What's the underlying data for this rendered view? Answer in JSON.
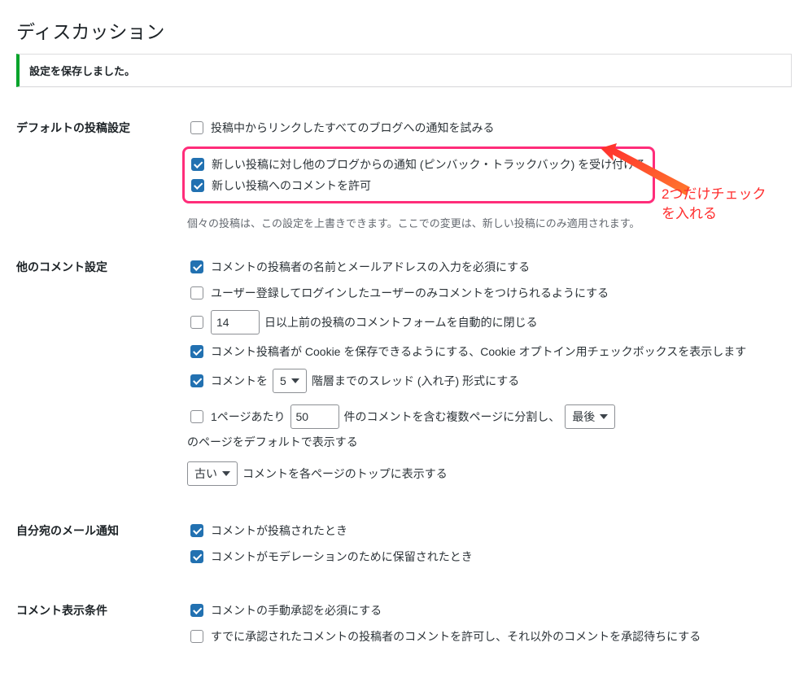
{
  "page": {
    "title": "ディスカッション",
    "saved_notice": "設定を保存しました。"
  },
  "sections": {
    "default_post": {
      "heading": "デフォルトの投稿設定",
      "pingback_send": "投稿中からリンクしたすべてのブログへの通知を試みる",
      "pingback_receive": "新しい投稿に対し他のブログからの通知 (ピンバック・トラックバック) を受け付ける",
      "allow_comments": "新しい投稿へのコメントを許可",
      "desc": "個々の投稿は、この設定を上書きできます。ここでの変更は、新しい投稿にのみ適用されます。"
    },
    "other": {
      "heading": "他のコメント設定",
      "require_name": "コメントの投稿者の名前とメールアドレスの入力を必須にする",
      "require_login": "ユーザー登録してログインしたユーザーのみコメントをつけられるようにする",
      "close_days_value": "14",
      "close_days_suffix": "日以上前の投稿のコメントフォームを自動的に閉じる",
      "cookie_optin": "コメント投稿者が Cookie を保存できるようにする、Cookie オプトイン用チェックボックスを表示します",
      "thread_prefix": "コメントを",
      "thread_value": "5",
      "thread_suffix": "階層までのスレッド (入れ子) 形式にする",
      "page_prefix": "1ページあたり",
      "page_value": "50",
      "page_mid": "件のコメントを含む複数ページに分割し、",
      "page_default_value": "最後",
      "page_suffix": "のページをデフォルトで表示する",
      "order_value": "古い",
      "order_suffix": "コメントを各ページのトップに表示する"
    },
    "email": {
      "heading": "自分宛のメール通知",
      "on_comment": "コメントが投稿されたとき",
      "on_moderation": "コメントがモデレーションのために保留されたとき"
    },
    "approval": {
      "heading": "コメント表示条件",
      "manual": "コメントの手動承認を必須にする",
      "known": "すでに承認されたコメントの投稿者のコメントを許可し、それ以外のコメントを承認待ちにする"
    }
  },
  "annotation": {
    "text": "2つだけチェック\nを入れる"
  }
}
